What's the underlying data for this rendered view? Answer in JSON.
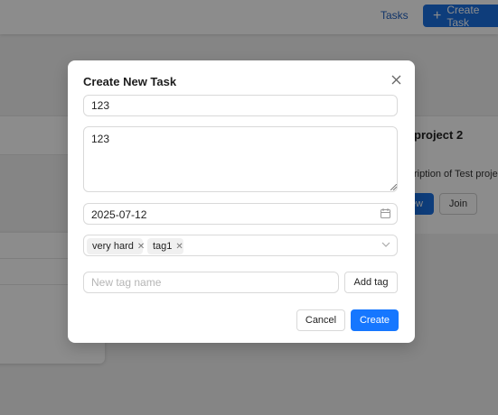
{
  "header": {
    "nav_tasks": "Tasks",
    "create_task_button": "Create Task"
  },
  "background": {
    "project_title": "project 2",
    "project_description": "ription of Test projec",
    "view_button": "ew",
    "join_button": "Join"
  },
  "modal": {
    "title": "Create New Task",
    "title_input_value": "123",
    "description_value": "123",
    "due_date": "2025-07-12",
    "tags": [
      "very hard",
      "tag1"
    ],
    "new_tag_placeholder": "New tag name",
    "add_tag_button": "Add tag",
    "cancel_button": "Cancel",
    "create_button": "Create"
  },
  "colors": {
    "primary": "#1677ff",
    "header_button": "#1a6fe0",
    "overlay": "rgba(0,0,0,0.45)"
  },
  "icons": [
    "close-icon",
    "calendar-icon",
    "chevron-down-icon",
    "plus-icon",
    "tag-remove-icon"
  ]
}
